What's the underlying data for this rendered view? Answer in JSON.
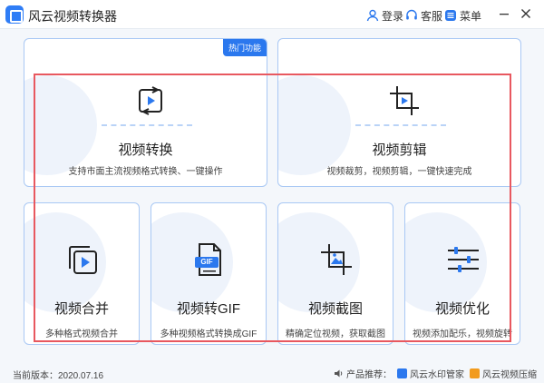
{
  "app": {
    "title": "风云视频转换器"
  },
  "titlebar": {
    "login": "登录",
    "service": "客服",
    "menu": "菜单"
  },
  "cards": {
    "convert": {
      "title": "视频转换",
      "desc": "支持市面主流视频格式转换、一键操作",
      "badge": "热门功能"
    },
    "edit": {
      "title": "视频剪辑",
      "desc": "视频裁剪，视频剪辑，一键快速完成"
    },
    "merge": {
      "title": "视频合并",
      "desc": "多种格式视频合并"
    },
    "gif": {
      "title": "视频转GIF",
      "desc": "多种视频格式转换成GIF",
      "icon_text": "GIF"
    },
    "screenshot": {
      "title": "视频截图",
      "desc": "精确定位视频，获取截图"
    },
    "optimize": {
      "title": "视频优化",
      "desc": "视频添加配乐，视频旋转"
    }
  },
  "footer": {
    "version": "当前版本：2020.07.16",
    "recommend": "产品推荐：",
    "product1": "风云水印管家",
    "product2": "风云视频压缩"
  },
  "colors": {
    "accent": "#2b78ee",
    "card_border": "#a9c8f4",
    "highlight": "#e8585f"
  }
}
